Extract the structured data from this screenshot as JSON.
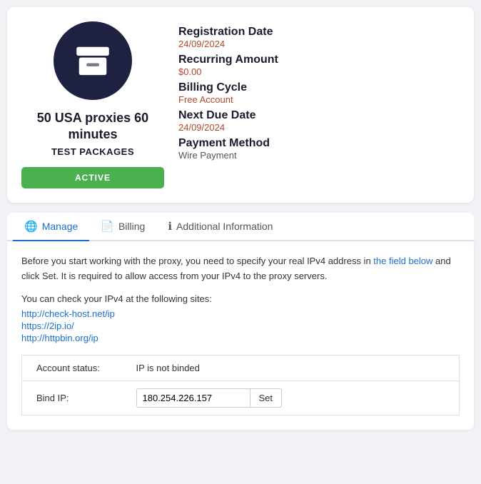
{
  "card": {
    "icon_label": "archive-box-icon",
    "title": "50 USA proxies 60 minutes",
    "subtitle": "TEST PACKAGES",
    "status": "ACTIVE",
    "status_color": "#4caf50"
  },
  "details": {
    "registration_date_label": "Registration Date",
    "registration_date_value": "24/09/2024",
    "recurring_amount_label": "Recurring Amount",
    "recurring_amount_value": "$0.00",
    "billing_cycle_label": "Billing Cycle",
    "billing_cycle_value": "Free Account",
    "next_due_date_label": "Next Due Date",
    "next_due_date_value": "24/09/2024",
    "payment_method_label": "Payment Method",
    "payment_method_value": "Wire Payment"
  },
  "tabs": [
    {
      "id": "manage",
      "label": "Manage",
      "icon": "🌐",
      "active": true
    },
    {
      "id": "billing",
      "label": "Billing",
      "icon": "📄",
      "active": false
    },
    {
      "id": "additional-info",
      "label": "Additional Information",
      "icon": "ℹ",
      "active": false
    }
  ],
  "content": {
    "description_part1": "Before you start working with the proxy, you need to specify your real IPv4 address in ",
    "description_highlight": "the field below",
    "description_part2": " and click Set. It is required to allow access from your IPv4 to the proxy servers.",
    "check_sites_label": "You can check your IPv4 at the following sites:",
    "sites": [
      "http://check-host.net/ip",
      "https://2ip.io/",
      "http://httpbin.org/ip"
    ],
    "account_status_label": "Account status:",
    "account_status_value": "IP is not binded",
    "bind_ip_label": "Bind IP:",
    "bind_ip_value": "180.254.226.157",
    "set_button_label": "Set"
  }
}
